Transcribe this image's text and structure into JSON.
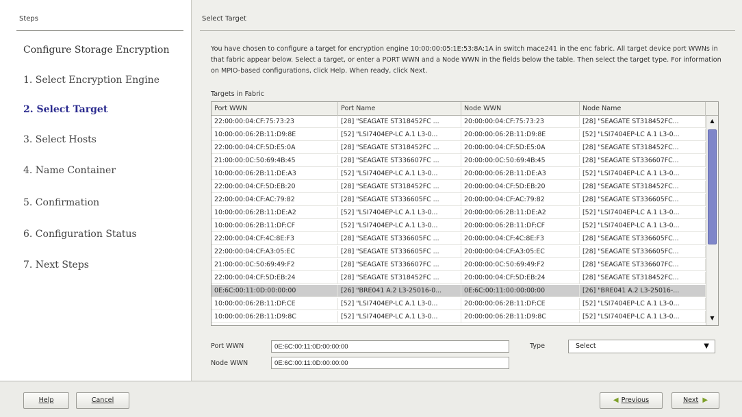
{
  "sidebar": {
    "header": "Steps",
    "title": "Configure Storage Encryption",
    "steps": [
      "1. Select Encryption Engine",
      "2. Select Target",
      "3. Select Hosts",
      "4. Name Container",
      "5. Confirmation",
      "6. Configuration Status",
      "7. Next Steps"
    ]
  },
  "main": {
    "header": "Select Target",
    "instructions": "You have chosen to configure a target for encryption engine 10:00:00:05:1E:53:8A:1A in switch mace241 in the enc fabric. All target device port WWNs in that fabric appear below. Select a target, or enter a PORT WWN and a Node WWN in the fields below the table. Then select the target type. For information on MPIO-based configurations, click Help. When ready, click Next.",
    "table_caption": "Targets in Fabric",
    "columns": [
      "Port WWN",
      "Port Name",
      "Node WWN",
      "Node Name"
    ],
    "rows": [
      [
        "22:00:00:04:CF:75:73:23",
        "[28] \"SEAGATE ST318452FC ...",
        "20:00:00:04:CF:75:73:23",
        "[28] \"SEAGATE ST318452FC..."
      ],
      [
        "10:00:00:06:2B:11:D9:8E",
        "[52] \"LSI7404EP-LC A.1 L3-0...",
        "20:00:00:06:2B:11:D9:8E",
        "[52] \"LSI7404EP-LC A.1 L3-0..."
      ],
      [
        "22:00:00:04:CF:5D:E5:0A",
        "[28] \"SEAGATE ST318452FC ...",
        "20:00:00:04:CF:5D:E5:0A",
        "[28] \"SEAGATE ST318452FC..."
      ],
      [
        "21:00:00:0C:50:69:4B:45",
        "[28] \"SEAGATE ST336607FC ...",
        "20:00:00:0C:50:69:4B:45",
        "[28] \"SEAGATE ST336607FC..."
      ],
      [
        "10:00:00:06:2B:11:DE:A3",
        "[52] \"LSI7404EP-LC A.1 L3-0...",
        "20:00:00:06:2B:11:DE:A3",
        "[52] \"LSI7404EP-LC A.1 L3-0..."
      ],
      [
        "22:00:00:04:CF:5D:EB:20",
        "[28] \"SEAGATE ST318452FC ...",
        "20:00:00:04:CF:5D:EB:20",
        "[28] \"SEAGATE ST318452FC..."
      ],
      [
        "22:00:00:04:CF:AC:79:82",
        "[28] \"SEAGATE ST336605FC ...",
        "20:00:00:04:CF:AC:79:82",
        "[28] \"SEAGATE ST336605FC..."
      ],
      [
        "10:00:00:06:2B:11:DE:A2",
        "[52] \"LSI7404EP-LC A.1 L3-0...",
        "20:00:00:06:2B:11:DE:A2",
        "[52] \"LSI7404EP-LC A.1 L3-0..."
      ],
      [
        "10:00:00:06:2B:11:DF:CF",
        "[52] \"LSI7404EP-LC A.1 L3-0...",
        "20:00:00:06:2B:11:DF:CF",
        "[52] \"LSI7404EP-LC A.1 L3-0..."
      ],
      [
        "22:00:00:04:CF:4C:8E:F3",
        "[28] \"SEAGATE ST336605FC ...",
        "20:00:00:04:CF:4C:8E:F3",
        "[28] \"SEAGATE ST336605FC..."
      ],
      [
        "22:00:00:04:CF:A3:05:EC",
        "[28] \"SEAGATE ST336605FC ...",
        "20:00:00:04:CF:A3:05:EC",
        "[28] \"SEAGATE ST336605FC..."
      ],
      [
        "21:00:00:0C:50:69:49:F2",
        "[28] \"SEAGATE ST336607FC ...",
        "20:00:00:0C:50:69:49:F2",
        "[28] \"SEAGATE ST336607FC..."
      ],
      [
        "22:00:00:04:CF:5D:EB:24",
        "[28] \"SEAGATE ST318452FC ...",
        "20:00:00:04:CF:5D:EB:24",
        "[28] \"SEAGATE ST318452FC..."
      ],
      [
        "0E:6C:00:11:0D:00:00:00",
        "[26] \"BRE041 A.2 L3-25016-0...",
        "0E:6C:00:11:00:00:00:00",
        "[26] \"BRE041 A.2 L3-25016-..."
      ],
      [
        "10:00:00:06:2B:11:DF:CE",
        "[52] \"LSI7404EP-LC A.1 L3-0...",
        "20:00:00:06:2B:11:DF:CE",
        "[52] \"LSI7404EP-LC A.1 L3-0..."
      ],
      [
        "10:00:00:06:2B:11:D9:8C",
        "[52] \"LSI7404EP-LC A.1 L3-0...",
        "20:00:00:06:2B:11:D9:8C",
        "[52] \"LSI7404EP-LC A.1 L3-0..."
      ]
    ],
    "selected_row": 13,
    "port_wwn_label": "Port WWN",
    "port_wwn_value": "0E:6C:00:11:0D:00:00:00",
    "node_wwn_label": "Node WWN",
    "node_wwn_value": "0E:6C:00:11:0D:00:00:00",
    "type_label": "Type",
    "type_value": "Select"
  },
  "footer": {
    "help": "Help",
    "cancel": "Cancel",
    "previous": "Previous",
    "next": "Next"
  },
  "icons": {
    "scroll_up": "▲",
    "scroll_down": "▼",
    "dropdown": "▼",
    "previous_arrow": "◀",
    "next_arrow": "▶"
  },
  "colors": {
    "current_step": "#2a2a8e",
    "selected_row": "#cdcdcd",
    "scroll_thumb": "#7f86c9",
    "nav_arrow": "#7ea02a"
  }
}
